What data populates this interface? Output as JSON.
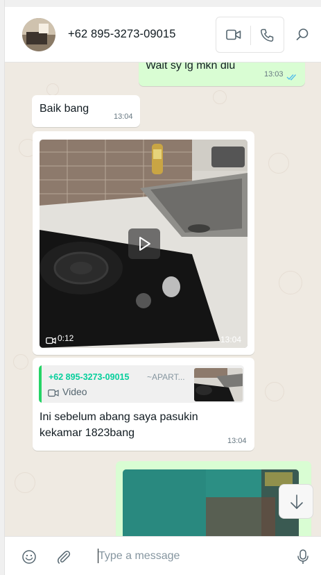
{
  "header": {
    "contact_name": "+62 895-3273-09015",
    "avatar_icon": "avatar",
    "video_call_icon": "video-camera-icon",
    "voice_call_icon": "phone-icon",
    "search_icon": "search-icon"
  },
  "messages": {
    "m1": {
      "text": "Wait sy lg mkn dlu",
      "time": "13:03",
      "status_icon": "double-check-icon",
      "status_color": "#53bdeb"
    },
    "m2": {
      "text": "Baik bang",
      "time": "13:04"
    },
    "m3": {
      "duration": "0:12",
      "time": "13:04",
      "play_icon": "play-icon"
    },
    "m4": {
      "quote_name": "+62 895-3273-09015",
      "quote_alias": "~APART...",
      "quote_media": "Video",
      "caption": "Ini sebelum abang saya pasukin kekamar 1823bang",
      "time": "13:04"
    }
  },
  "scroll_down_icon": "arrow-down-icon",
  "composer": {
    "placeholder": "Type a message",
    "emoji_icon": "emoji-icon",
    "attach_icon": "paperclip-icon",
    "mic_icon": "microphone-icon"
  },
  "colors": {
    "outgoing_bubble": "#d9fdd3",
    "incoming_bubble": "#ffffff",
    "chat_background": "#efeae2",
    "accent": "#25d366",
    "read_ticks": "#53bdeb"
  }
}
